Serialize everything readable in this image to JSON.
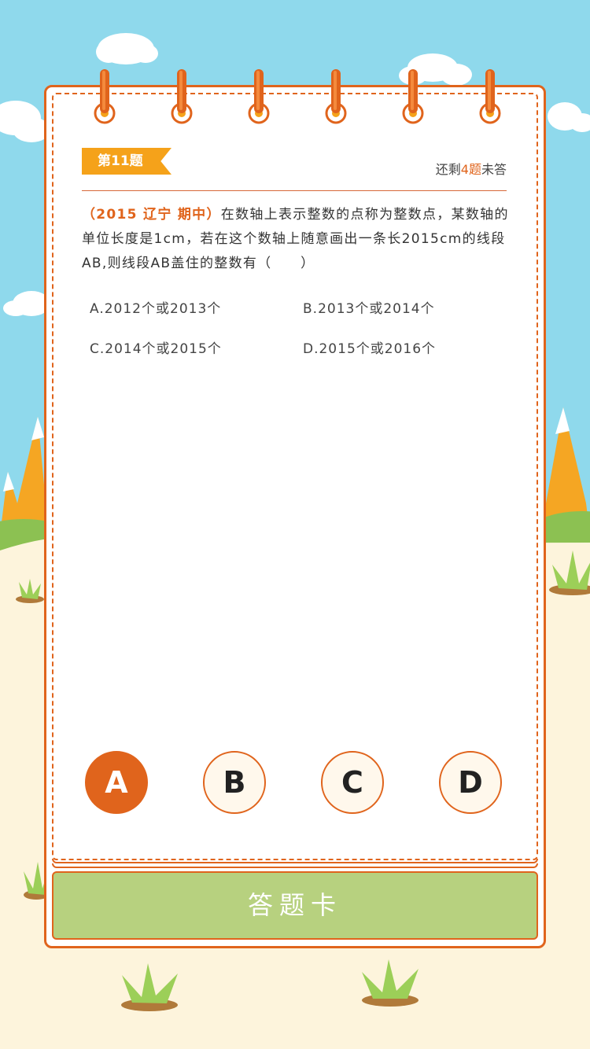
{
  "question_badge": "第11题",
  "remaining": {
    "prefix": "还剩",
    "count": "4题",
    "suffix": "未答"
  },
  "question": {
    "source": "（2015 辽宁 期中）",
    "text": "在数轴上表示整数的点称为整数点，某数轴的单位长度是1cm，若在这个数轴上随意画出一条长2015cm的线段AB,则线段AB盖住的整数有（　　）"
  },
  "options": [
    {
      "text": "A.2012个或2013个"
    },
    {
      "text": "B.2013个或2014个"
    },
    {
      "text": "C.2014个或2015个"
    },
    {
      "text": "D.2015个或2016个"
    }
  ],
  "answer_buttons": [
    "A",
    "B",
    "C",
    "D"
  ],
  "selected_answer": "A",
  "answer_card_label": "答题卡",
  "colors": {
    "accent": "#e0641c",
    "badge": "#f5a21a",
    "sky": "#8fd9ec",
    "card": "#b7d17f",
    "ground": "#fdf4dc"
  }
}
